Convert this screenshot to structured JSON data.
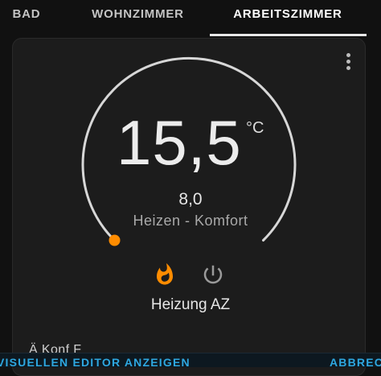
{
  "tabs": [
    {
      "label": "BAD"
    },
    {
      "label": "WOHNZIMMER"
    },
    {
      "label": "ARBEITSZIMMER"
    }
  ],
  "thermostat": {
    "target_temperature": "15,5",
    "unit": "°C",
    "current_value": "8,0",
    "status": "Heizen - Komfort",
    "name": "Heizung AZ",
    "level": 0.0
  },
  "modes": [
    {
      "icon": "flame-icon",
      "active": true
    },
    {
      "icon": "power-icon",
      "active": false
    }
  ],
  "hint": "Ä                                    Konf                                   F",
  "bottom_bar": {
    "left_label": "VISUELLEN EDITOR ANZEIGEN",
    "right_label": "ABBRECH"
  },
  "colors": {
    "accent": "#ff8c00",
    "link": "#2ea7e0"
  }
}
